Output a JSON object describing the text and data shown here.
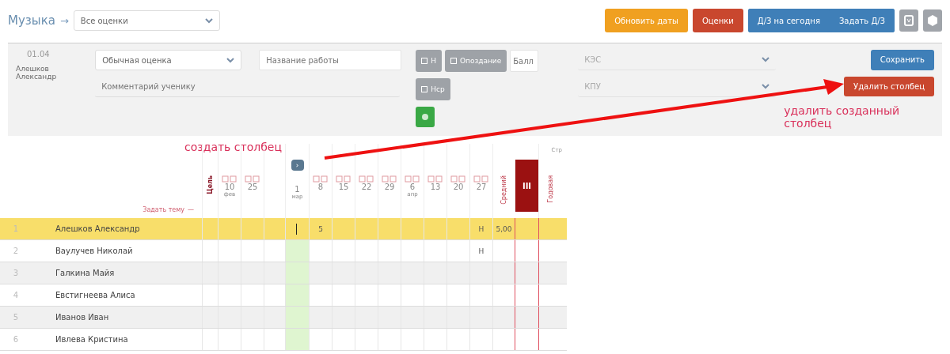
{
  "header": {
    "subject": "Музыка",
    "separator": "→",
    "filter": {
      "value": "Все оценки"
    },
    "buttons": [
      {
        "label": "Обновить даты",
        "kind": "orange"
      },
      {
        "label": "Оценки",
        "kind": "red"
      },
      {
        "label": "Д/З на сегодня",
        "kind": "blue"
      },
      {
        "label": "Задать Д/З",
        "kind": "blue"
      }
    ]
  },
  "editor": {
    "date": "01.04",
    "student": "Алешков Александр",
    "mark_type": "Обычная оценка",
    "work_title": {
      "placeholder": "Название работы"
    },
    "comment": {
      "placeholder": "Комментарий ученику"
    },
    "toggles": [
      {
        "label": "Н",
        "checked": false
      },
      {
        "label": "Опоздание",
        "checked": false
      },
      {
        "label": "Нср",
        "checked": false
      }
    ],
    "points": {
      "placeholder": "Балл"
    },
    "kes": {
      "placeholder": "КЭС"
    },
    "kpu": {
      "placeholder": "КПУ"
    },
    "save": "Сохранить",
    "delete": "Удалить столбец"
  },
  "annotations": {
    "delete_hint": "удалить созданный столбец",
    "create_hint": "создать столбец"
  },
  "table": {
    "page_label": "Стр",
    "topic_link": "Задать тему",
    "topic_dash": "—",
    "columns": [
      {
        "kind": "goal",
        "label": "Цель"
      },
      {
        "kind": "date",
        "day": "10",
        "month": "фев"
      },
      {
        "kind": "date",
        "day": "25"
      },
      {
        "kind": "blank"
      },
      {
        "kind": "new",
        "day": "1",
        "month": "мар",
        "button": "›"
      },
      {
        "kind": "date",
        "day": "8"
      },
      {
        "kind": "date",
        "day": "15"
      },
      {
        "kind": "date",
        "day": "22"
      },
      {
        "kind": "date",
        "day": "29"
      },
      {
        "kind": "date",
        "day": "6",
        "month": "апр"
      },
      {
        "kind": "date",
        "day": "13"
      },
      {
        "kind": "date",
        "day": "20"
      },
      {
        "kind": "date",
        "day": "27"
      },
      {
        "kind": "average",
        "label": "Средний"
      },
      {
        "kind": "term",
        "label": "III"
      },
      {
        "kind": "year",
        "label": "Годовая"
      }
    ],
    "rows": [
      {
        "num": "1",
        "name": "Алешков Александр",
        "selected": true,
        "cells": [
          null,
          null,
          null,
          null,
          null,
          "5",
          null,
          null,
          null,
          null,
          null,
          null,
          "Н",
          "5,00",
          null,
          null
        ]
      },
      {
        "num": "2",
        "name": "Baулучев Николай",
        "selected": false,
        "cells": [
          null,
          null,
          null,
          null,
          null,
          null,
          null,
          null,
          null,
          null,
          null,
          null,
          "Н",
          null,
          null,
          null
        ]
      },
      {
        "num": "3",
        "name": "Галкина Майя",
        "selected": false,
        "cells": []
      },
      {
        "num": "4",
        "name": "Евстигнеева Алиса",
        "selected": false,
        "cells": []
      },
      {
        "num": "5",
        "name": "Иванов Иван",
        "selected": false,
        "cells": []
      },
      {
        "num": "6",
        "name": "Ивлева Кристина",
        "selected": false,
        "cells": []
      }
    ]
  }
}
